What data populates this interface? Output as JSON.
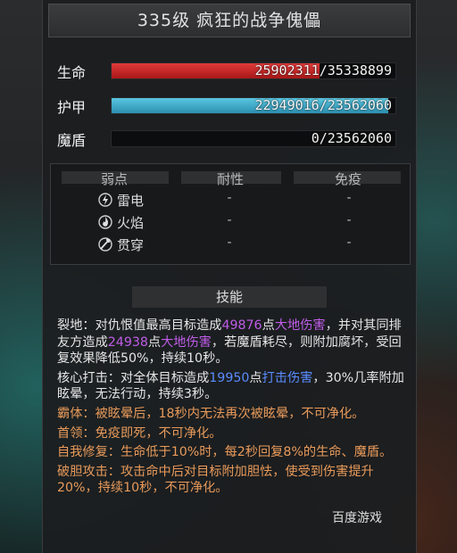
{
  "title": "335级  疯狂的战争傀儡",
  "stats": [
    {
      "label": "生命",
      "value_text": "25902311/35338899",
      "fill": 0.733,
      "color": "#d02a2a"
    },
    {
      "label": "护甲",
      "value_text": "22949016/23562060",
      "fill": 0.974,
      "color": "#3aa8c8"
    },
    {
      "label": "魔盾",
      "value_text": "0/23562060",
      "fill": 0,
      "color": "#111111"
    }
  ],
  "resist": {
    "headers": [
      "弱点",
      "耐性",
      "免疫"
    ],
    "rows": [
      {
        "name": "雷电",
        "icon": "lightning-icon",
        "res": "-",
        "imm": "-"
      },
      {
        "name": "火焰",
        "icon": "fire-icon",
        "res": "-",
        "imm": "-"
      },
      {
        "name": "贯穿",
        "icon": "pierce-icon",
        "res": "-",
        "imm": "-"
      }
    ]
  },
  "skills_header": "技能",
  "skills": [
    {
      "parts": [
        [
          "w",
          "裂地：对仇恨值最高目标造成"
        ],
        [
          "p",
          "49876"
        ],
        [
          "w",
          "点"
        ],
        [
          "p",
          "大地伤害"
        ],
        [
          "w",
          "，并对其同排友方造成"
        ],
        [
          "p",
          "24938"
        ],
        [
          "w",
          "点"
        ],
        [
          "p",
          "大地伤害"
        ],
        [
          "w",
          "，若魔盾耗尽，则附加腐坏，受回复效果降低50%，持续10秒。"
        ]
      ]
    },
    {
      "parts": [
        [
          "w",
          "核心打击：对全体目标造成"
        ],
        [
          "b",
          "19950"
        ],
        [
          "w",
          "点"
        ],
        [
          "b",
          "打击伤害"
        ],
        [
          "w",
          "，30%几率附加眩晕，无法行动，持续3秒。"
        ]
      ]
    },
    {
      "parts": [
        [
          "o",
          "霸体：被眩晕后，18秒内无法再次被眩晕，不可净化。"
        ]
      ]
    },
    {
      "parts": [
        [
          "o",
          "首领：免疫即死，不可净化。"
        ]
      ]
    },
    {
      "parts": [
        [
          "o",
          "自我修复：生命低于10%时，每2秒回复8%的生命、魔盾。"
        ]
      ]
    },
    {
      "parts": [
        [
          "o",
          "破胆攻击：攻击命中后对目标附加胆怯，使受到伤害提升20%，持续10秒，不可净化。"
        ]
      ]
    }
  ],
  "watermark": "百度游戏",
  "colors": {
    "orange": "#e89a5a",
    "purple": "#c05ce8",
    "blue": "#5a8cff"
  }
}
